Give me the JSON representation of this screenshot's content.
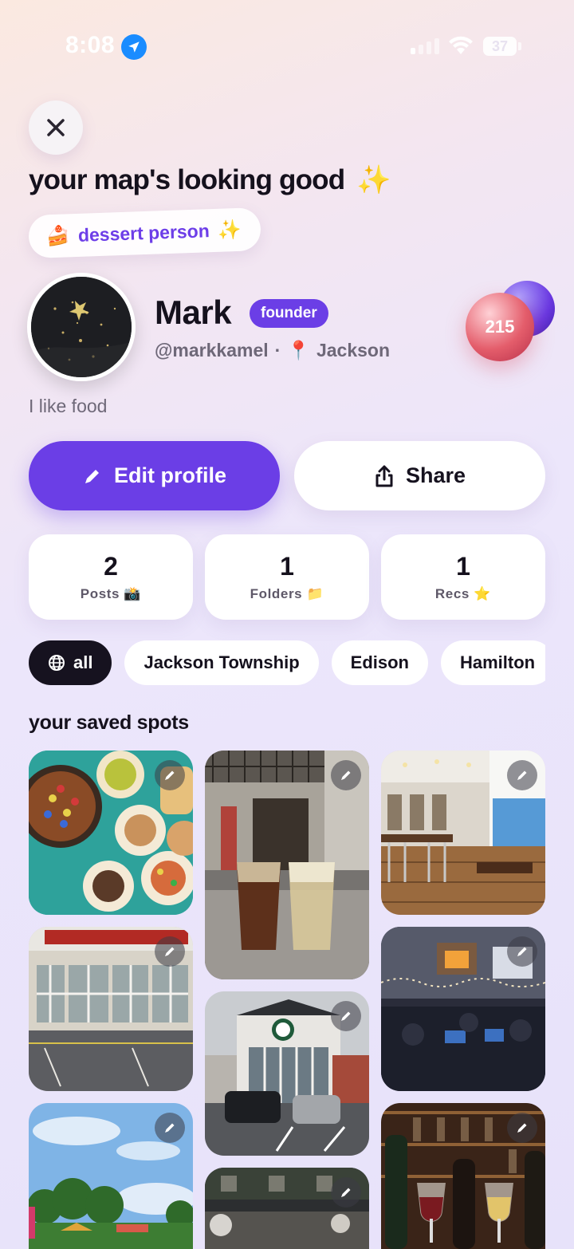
{
  "status_bar": {
    "time": "8:08",
    "battery": "37"
  },
  "header": {
    "headline": "your map's looking good",
    "headline_emoji": "✨"
  },
  "persona_badge": {
    "emoji": "🍰",
    "label": "dessert person",
    "sparkle": "✨"
  },
  "profile": {
    "name": "Mark",
    "role_badge": "founder",
    "handle": "@markkamel",
    "separator": "·",
    "pin_emoji": "📍",
    "location": "Jackson",
    "bio": "I like food",
    "points": "215"
  },
  "actions": {
    "edit_label": "Edit profile",
    "share_label": "Share"
  },
  "stats": [
    {
      "value": "2",
      "label": "Posts",
      "emoji": "📸"
    },
    {
      "value": "1",
      "label": "Folders",
      "emoji": "📁"
    },
    {
      "value": "1",
      "label": "Recs",
      "emoji": "⭐"
    }
  ],
  "filters": [
    {
      "label": "all",
      "active": true
    },
    {
      "label": "Jackson Township"
    },
    {
      "label": "Edison"
    },
    {
      "label": "Hamilton"
    }
  ],
  "saved_section": {
    "title": "your saved spots"
  },
  "tiles": [
    {
      "name": "dessert-platter-photo"
    },
    {
      "name": "storefront-photo"
    },
    {
      "name": "park-photo"
    },
    {
      "name": "beer-glasses-photo"
    },
    {
      "name": "brewery-building-photo"
    },
    {
      "name": "outdoor-bar-photo"
    },
    {
      "name": "restaurant-interior-photo"
    },
    {
      "name": "cafe-dining-photo"
    },
    {
      "name": "wine-bar-photo"
    }
  ],
  "colors": {
    "accent": "#6b3ee6",
    "dark_chip": "#16121f"
  }
}
